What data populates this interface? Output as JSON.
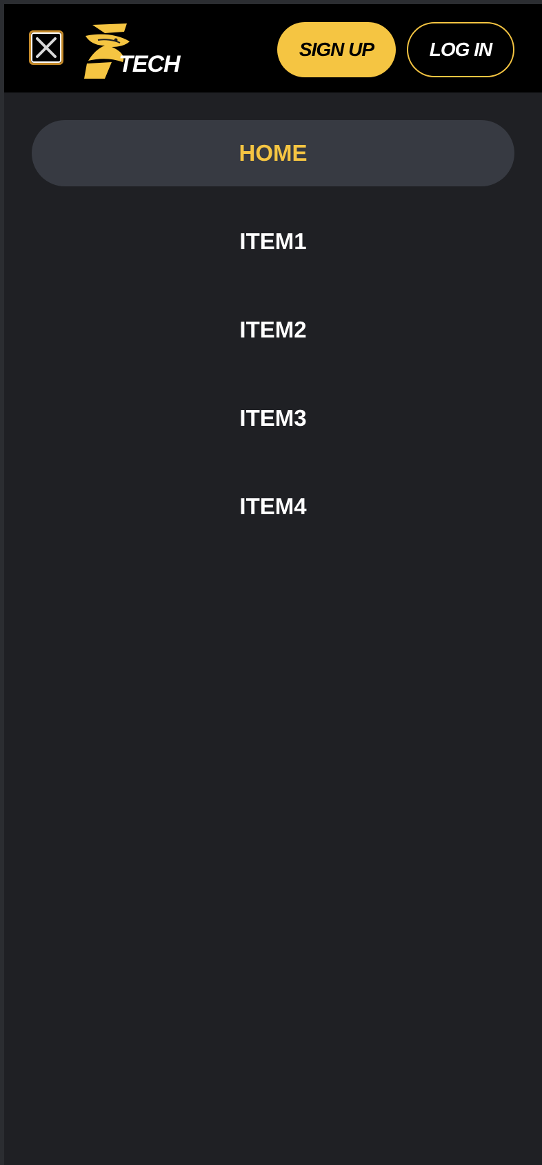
{
  "header": {
    "close_icon": "close-icon",
    "logo_text": "TECH",
    "signup_label": "SIGN UP",
    "login_label": "LOG IN"
  },
  "menu": {
    "items": [
      {
        "label": "HOME",
        "active": true
      },
      {
        "label": "ITEM1",
        "active": false
      },
      {
        "label": "ITEM2",
        "active": false
      },
      {
        "label": "ITEM3",
        "active": false
      },
      {
        "label": "ITEM4",
        "active": false
      }
    ]
  },
  "colors": {
    "accent": "#f5c542",
    "background": "#1f2024",
    "header": "#000000",
    "active_item": "#373a42"
  }
}
